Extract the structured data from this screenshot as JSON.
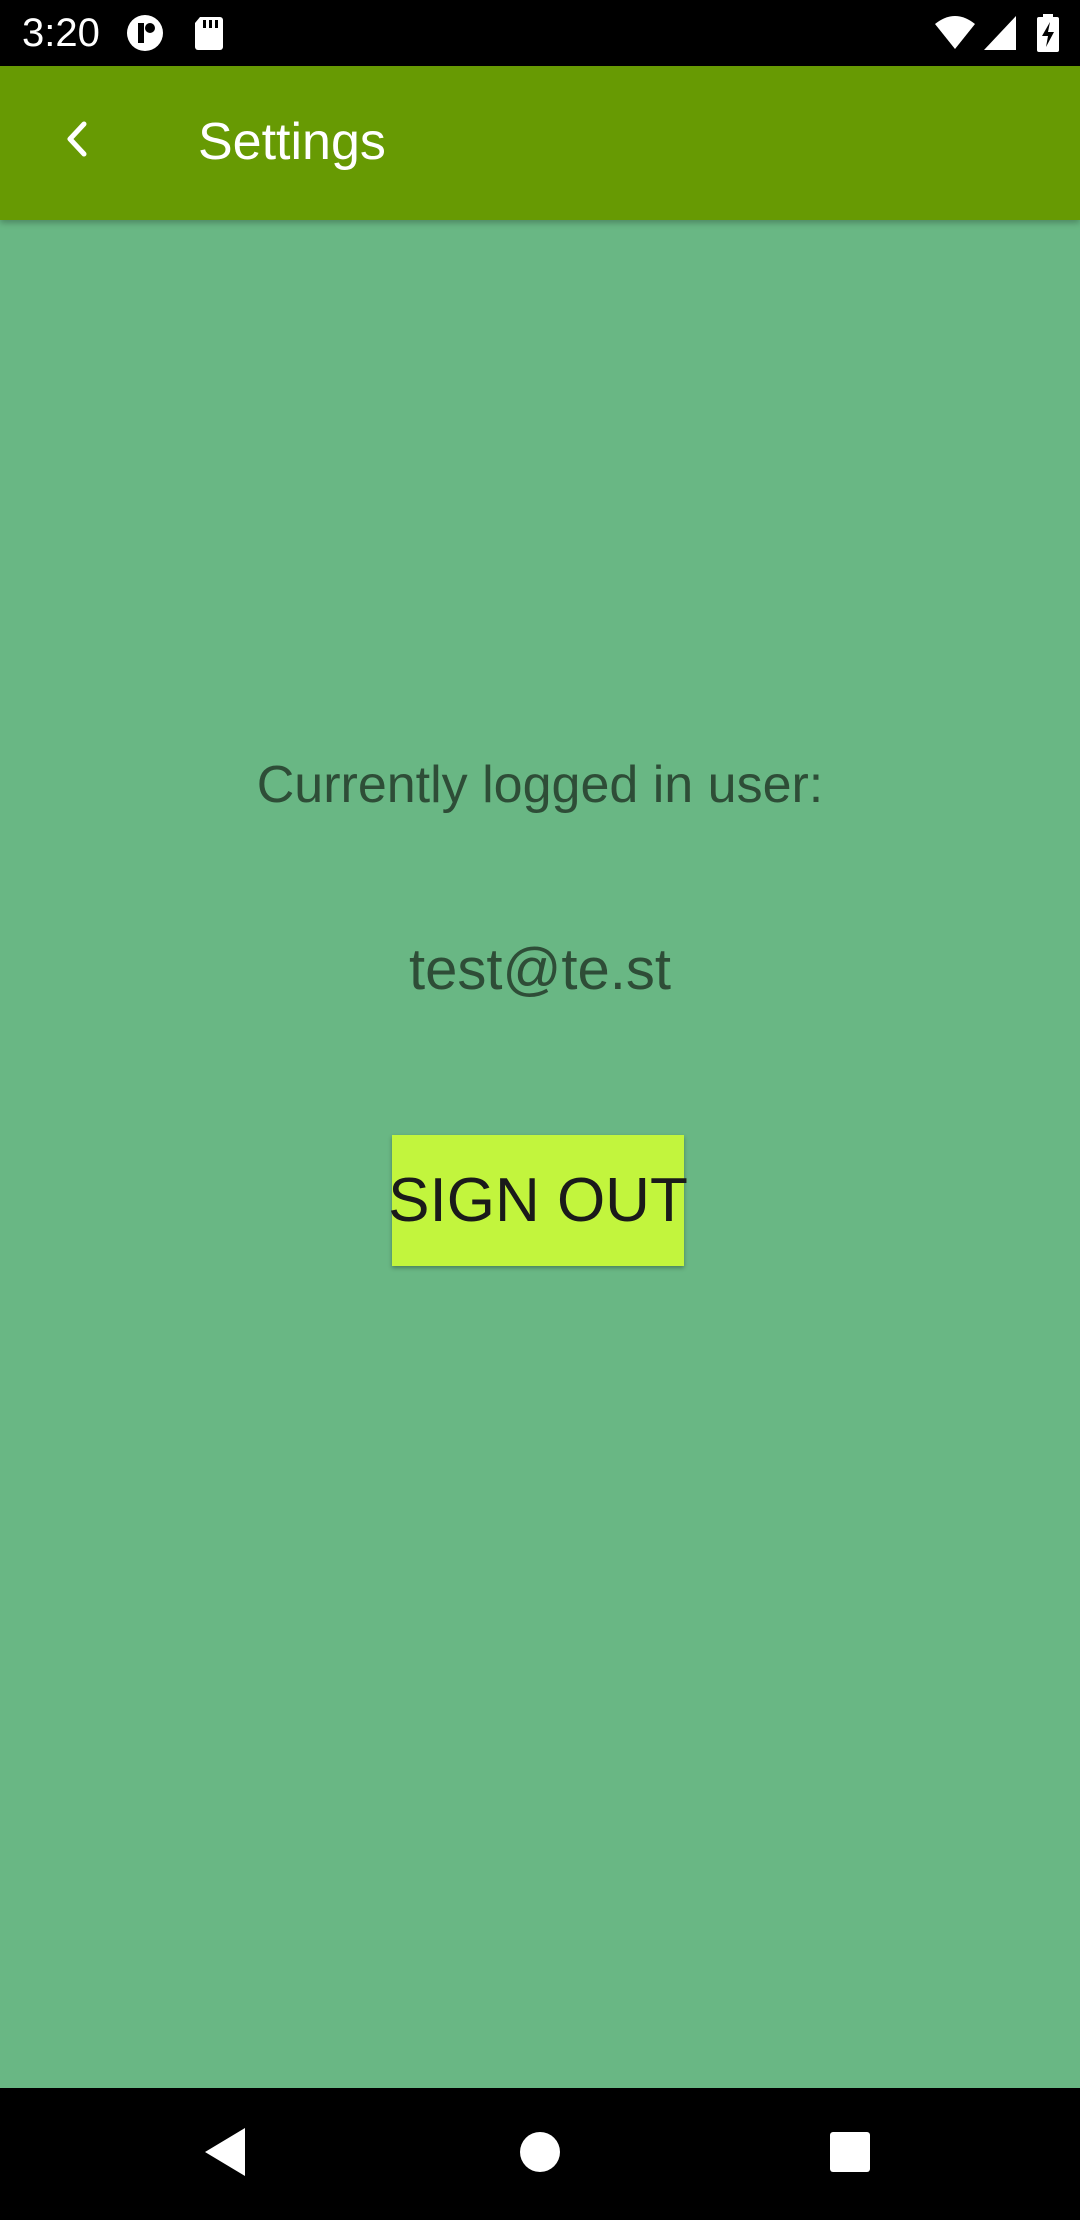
{
  "status_bar": {
    "time": "3:20",
    "icons": [
      "notification-app-icon",
      "sd-card-icon",
      "wifi-icon",
      "cell-signal-icon",
      "battery-charging-icon"
    ]
  },
  "app_bar": {
    "title": "Settings",
    "back_icon": "chevron-left-icon",
    "color": "#679a03"
  },
  "content": {
    "label": "Currently logged in user:",
    "email": "test@te.st",
    "signout_label": "SIGN OUT",
    "background": "#69b784",
    "button_color": "#c2f53d"
  },
  "nav_bar": {
    "icons": [
      "back-triangle-icon",
      "home-circle-icon",
      "recents-square-icon"
    ]
  }
}
